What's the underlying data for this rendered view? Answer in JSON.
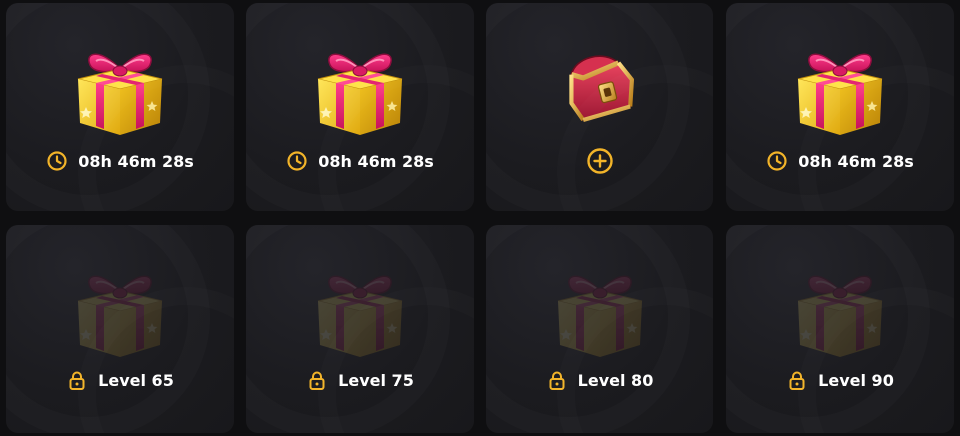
{
  "slots": [
    {
      "type": "gift",
      "timer": "08h 46m 28s"
    },
    {
      "type": "gift",
      "timer": "08h 46m 28s"
    },
    {
      "type": "chest",
      "action": "add"
    },
    {
      "type": "gift",
      "timer": "08h 46m 28s"
    },
    {
      "type": "gift-locked",
      "label": "Level 65"
    },
    {
      "type": "gift-locked",
      "label": "Level 75"
    },
    {
      "type": "gift-locked",
      "label": "Level 80"
    },
    {
      "type": "gift-locked",
      "label": "Level 90"
    }
  ],
  "icons": {
    "timer": "clock-icon",
    "locked": "lock-icon",
    "add": "plus-circle-icon"
  },
  "colors": {
    "accent": "#f2b429",
    "slot_bg": "#1c1c20",
    "page_bg": "#0f0f11",
    "text": "#ffffff"
  }
}
